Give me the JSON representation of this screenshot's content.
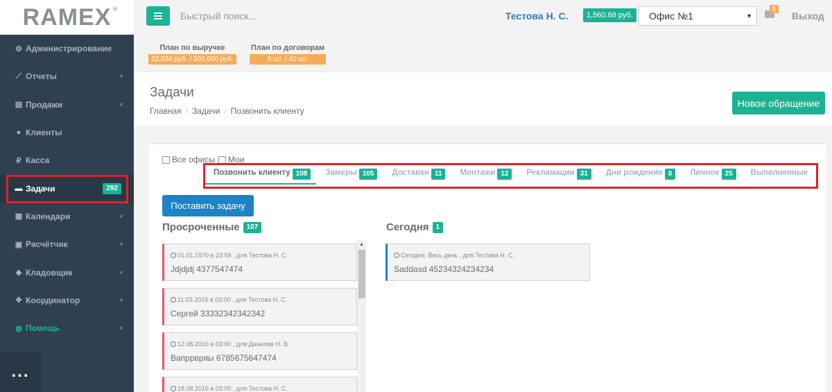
{
  "brand": {
    "logo": "RAMEX",
    "reg": "®"
  },
  "topbar": {
    "search_placeholder": "Быстрый поиск...",
    "user": "Тестова Н. С.",
    "balance": "1,560.68 руб.",
    "office": "Офис №1",
    "mail_count": "5",
    "logout": "Выход"
  },
  "plans": [
    {
      "title": "План по выручке",
      "value": "32,934 руб. / 500,000 руб."
    },
    {
      "title": "План по договорам",
      "value": "3 шт. / 40 шт."
    }
  ],
  "sidebar": {
    "items": [
      {
        "label": "Администрирование",
        "icon": "gear-icon"
      },
      {
        "label": "Отчеты",
        "icon": "chart-icon"
      },
      {
        "label": "Продажи",
        "icon": "file-icon"
      },
      {
        "label": "Клиенты",
        "icon": "users-icon"
      },
      {
        "label": "Касса",
        "icon": "ruble-icon"
      },
      {
        "label": "Задачи",
        "icon": "tasks-icon",
        "badge": "292"
      },
      {
        "label": "Календари",
        "icon": "calendar-icon"
      },
      {
        "label": "Расчётчик",
        "icon": "calculator-icon"
      },
      {
        "label": "Кладовщик",
        "icon": "cubes-icon"
      },
      {
        "label": "Координатор",
        "icon": "arrows-icon"
      },
      {
        "label": "Помощь",
        "icon": "help-icon"
      }
    ],
    "more": "..."
  },
  "page": {
    "title": "Задачи",
    "breadcrumb": [
      "Главная",
      "Задачи",
      "Позвонить клиенту"
    ],
    "new_button": "Новое обращение"
  },
  "filters": {
    "all_offices": "Все офисы",
    "mine": "Мои"
  },
  "tabs": [
    {
      "label": "Позвонить клиенту",
      "count": "108"
    },
    {
      "label": "Замеры",
      "count": "105"
    },
    {
      "label": "Доставки",
      "count": "11"
    },
    {
      "label": "Монтажи",
      "count": "12"
    },
    {
      "label": "Рекламации",
      "count": "31"
    },
    {
      "label": "Дни рождения",
      "count": "0"
    },
    {
      "label": "Личное",
      "count": "25"
    },
    {
      "label": "Выполненные",
      "count": ""
    }
  ],
  "add_task_button": "Поставить задачу",
  "overdue": {
    "title": "Просроченные",
    "count": "107",
    "cards": [
      {
        "meta": "01.01.1970 в 23:59 , для Тестова Н. С.",
        "text": "Jdjdjdj 4377547474"
      },
      {
        "meta": "11.03.2016 в 03:00 , для Тестова Н. С.",
        "text": "Сергей 33332342342342"
      },
      {
        "meta": "12.08.2016 в 03:00 , для Данилов Н. В.",
        "text": "Вапррвряы 6785675647474"
      },
      {
        "meta": "18.08.2016 в 03:00 , для Тестова Н. С.",
        "text": ""
      }
    ]
  },
  "today": {
    "title": "Сегодня",
    "count": "1",
    "cards": [
      {
        "meta": "Сегодня, Весь день , для Тестова Н. С.",
        "text": "Saddasd 45234324234234"
      }
    ]
  },
  "colors": {
    "accent": "#1ab394",
    "sidebar": "#2f4050",
    "primary": "#1c84c6",
    "warning": "#f8ac59",
    "danger": "#ed5565",
    "highlight": "#e0212a"
  }
}
